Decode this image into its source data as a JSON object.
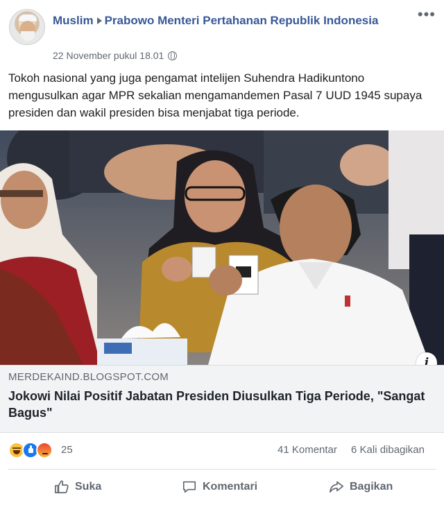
{
  "post": {
    "author": "Muslim",
    "group": "Prabowo Menteri Pertahanan Republik Indonesia",
    "timestamp": "22 November pukul 18.01",
    "privacy_icon": "globe-icon",
    "text": "Tokoh nasional yang juga pengamat intelijen Suhendra Hadikuntono mengusulkan agar MPR sekalian mengamandemen Pasal 7 UUD 1945 supaya presiden dan wakil presiden bisa menjabat tiga periode."
  },
  "link": {
    "domain": "MERDEKAIND.BLOGSPOT.COM",
    "title": "Jokowi Nilai Positif Jabatan Presiden Diusulkan Tiga Periode, \"Sangat Bagus\""
  },
  "stats": {
    "reaction_icons": [
      "haha-icon",
      "like-icon",
      "angry-icon"
    ],
    "reaction_count": "25",
    "comments": "41 Komentar",
    "shares": "6 Kali dibagikan"
  },
  "actions": {
    "like": "Suka",
    "comment": "Komentari",
    "share": "Bagikan"
  },
  "colors": {
    "link_blue": "#385898",
    "meta_gray": "#606770",
    "like_blue": "#1877f2",
    "link_box_bg": "#f2f3f5"
  }
}
